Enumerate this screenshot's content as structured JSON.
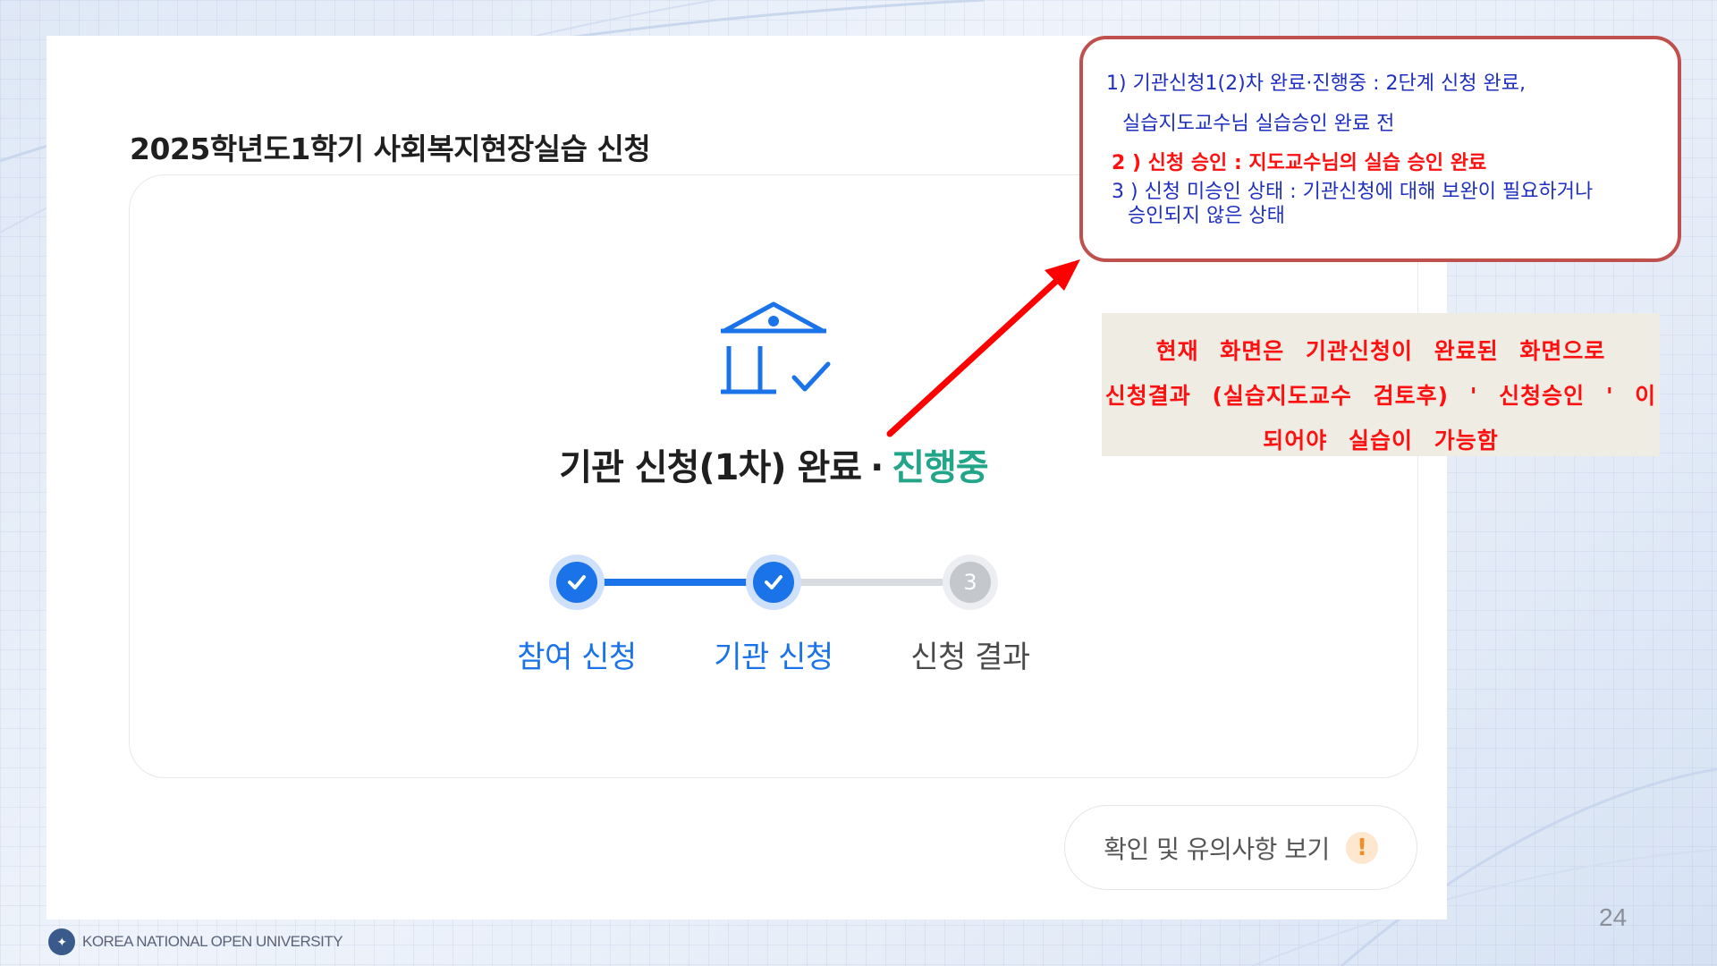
{
  "page": {
    "title": "2025학년도1학기 사회복지현장실습 신청",
    "number": "24"
  },
  "status": {
    "headline_main": "기관 신청(1차) 완료",
    "headline_dot": "·",
    "headline_progress": "진행중",
    "icon": "institution-check-icon"
  },
  "steps": [
    {
      "label": "참여 신청",
      "state": "done"
    },
    {
      "label": "기관 신청",
      "state": "done"
    },
    {
      "label": "신청 결과",
      "state": "todo",
      "number": "3"
    }
  ],
  "notice_button": {
    "label": "확인 및 유의사항 보기",
    "badge": "!"
  },
  "callout": {
    "line1": "1) 기관신청1(2)차 완료·진행중 : 2단계 신청 완료,",
    "line2": "실습지도교수님 실습승인 완료 전",
    "line3": "2 ) 신청 승인 : 지도교수님의 실습 승인 완료",
    "line4": "3 ) 신청 미승인 상태 : 기관신청에 대해 보완이 필요하거나",
    "line5": "승인되지 않은 상태"
  },
  "note": {
    "line1": "현재 화면은 기관신청이 완료된 화면으로",
    "line2": "신청결과 (실습지도교수 검토후) ' 신청승인 ' 이",
    "line3": "되어야 실습이 가능함"
  },
  "footer": {
    "brand": "KOREA NATIONAL OPEN UNIVERSITY"
  },
  "colors": {
    "accent_blue": "#1a73e8",
    "progress_green": "#23a58a",
    "annotation_red": "#ff1010",
    "callout_border": "#c0504d"
  }
}
